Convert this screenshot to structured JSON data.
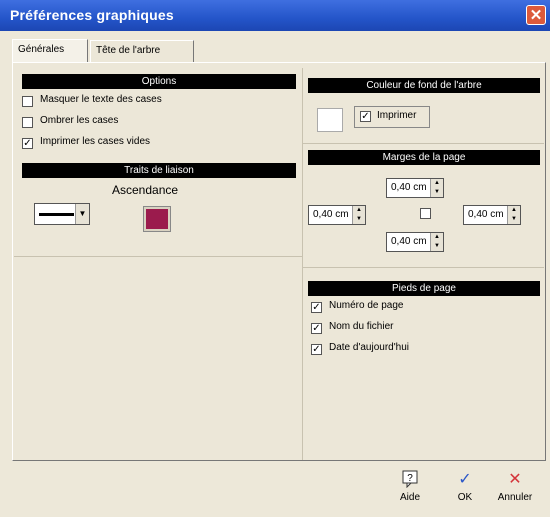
{
  "window": {
    "title": "Préférences graphiques",
    "close_glyph": "✕"
  },
  "tabs": [
    {
      "label": "Générales"
    },
    {
      "label": "Tête de l'arbre"
    }
  ],
  "options": {
    "header": "Options",
    "items": [
      {
        "label": "Masquer le texte des cases",
        "checked": false
      },
      {
        "label": "Ombrer les cases",
        "checked": false
      },
      {
        "label": "Imprimer les cases vides",
        "checked": true
      }
    ]
  },
  "traits": {
    "header": "Traits de liaison",
    "ascendance_label": "Ascendance",
    "ascendance_color": "#9b1b4d"
  },
  "couleur_fond": {
    "header": "Couleur de fond de l'arbre",
    "swatch_color": "#ffffff",
    "imprimer_label": "Imprimer",
    "imprimer_checked": true
  },
  "marges": {
    "header": "Marges de la page",
    "top": "0,40 cm",
    "left": "0,40 cm",
    "right": "0,40 cm",
    "bottom": "0,40 cm",
    "center_checked": false
  },
  "pieds": {
    "header": "Pieds de page",
    "items": [
      {
        "label": "Numéro de page",
        "checked": true
      },
      {
        "label": "Nom du fichier",
        "checked": true
      },
      {
        "label": "Date d'aujourd'hui",
        "checked": true
      }
    ]
  },
  "buttons": {
    "aide": {
      "label": "Aide",
      "icon": "help-icon"
    },
    "ok": {
      "label": "OK",
      "icon": "checkmark-icon"
    },
    "annuler": {
      "label": "Annuler",
      "icon": "cancel-x-icon"
    }
  },
  "check_glyph": "✓"
}
